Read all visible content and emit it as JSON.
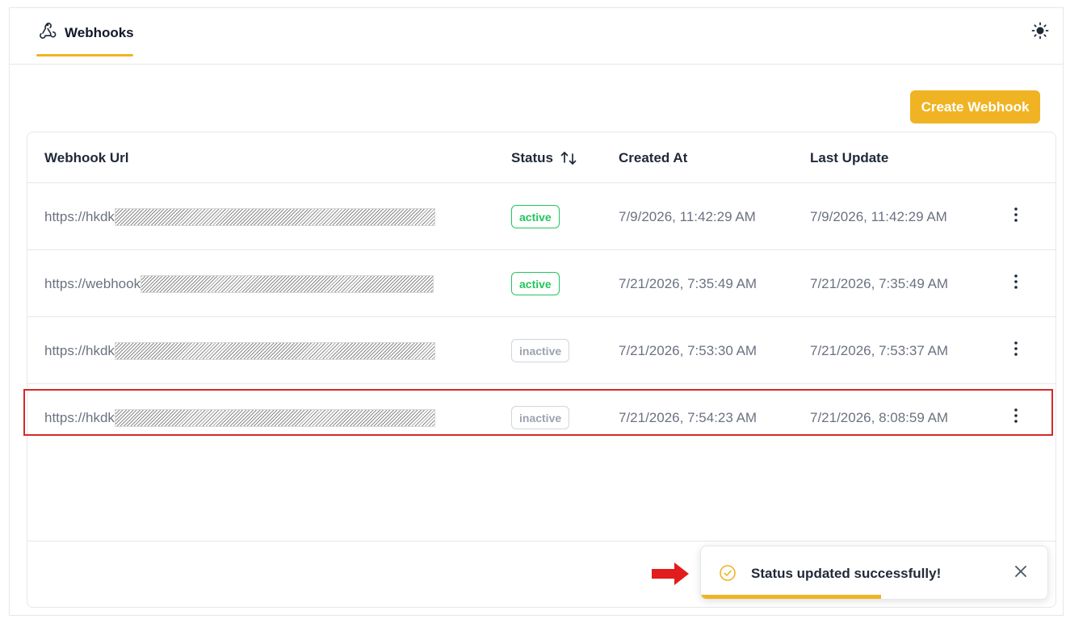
{
  "topbar": {
    "tab_label": "Webhooks",
    "tab_icon": "webhook-icon",
    "theme_icon": "sun-icon"
  },
  "toolbar": {
    "create_label": "Create Webhook"
  },
  "table": {
    "headers": {
      "url": "Webhook Url",
      "status": "Status",
      "created": "Created At",
      "updated": "Last Update"
    },
    "rows": [
      {
        "url_prefix": "https://hkdk",
        "status": "active",
        "created": "7/9/2026, 11:42:29 AM",
        "updated": "7/9/2026, 11:42:29 AM"
      },
      {
        "url_prefix": "https://webhook",
        "status": "active",
        "created": "7/21/2026, 7:35:49 AM",
        "updated": "7/21/2026, 7:35:49 AM"
      },
      {
        "url_prefix": "https://hkdk",
        "status": "inactive",
        "created": "7/21/2026, 7:53:30 AM",
        "updated": "7/21/2026, 7:53:37 AM"
      },
      {
        "url_prefix": "https://hkdk",
        "status": "inactive",
        "created": "7/21/2026, 7:54:23 AM",
        "updated": "7/21/2026, 8:08:59 AM"
      }
    ]
  },
  "toast": {
    "message": "Status updated successfully!",
    "progress": 0.52
  },
  "colors": {
    "accent": "#f0b323",
    "active": "#22c55e",
    "inactive": "#9ca3af",
    "highlight": "#d62828"
  }
}
